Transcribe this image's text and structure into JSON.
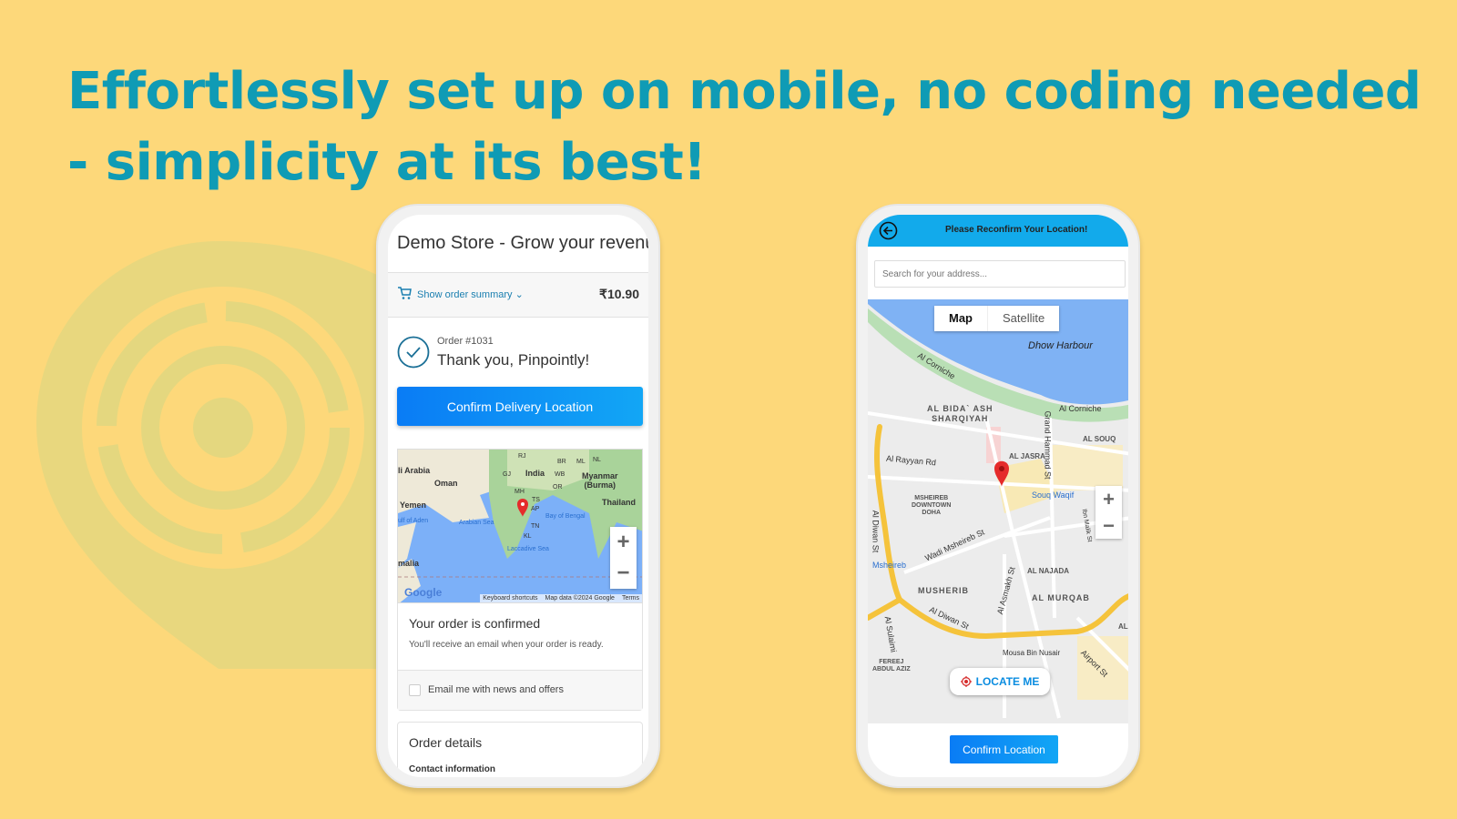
{
  "headline": "Effortlessly set up on mobile, no coding needed - simplicity at its best!",
  "colors": {
    "background": "#fdd87a",
    "headline": "#0f9bb5",
    "primary_button": "#0a8cf5",
    "header_blue": "#12aaeb"
  },
  "left_phone": {
    "store_title": "Demo Store - Grow your revenue",
    "order_summary_label": "Show order summary",
    "order_total": "₹10.90",
    "order_number": "Order #1031",
    "thank_you": "Thank you, Pinpointly!",
    "confirm_button": "Confirm Delivery Location",
    "map": {
      "labels": [
        "li Arabia",
        "Oman",
        "Yemen",
        "India",
        "Myanmar\n(Burma)",
        "Thailand",
        "malia",
        "RJ",
        "GJ",
        "MH",
        "TS",
        "AP",
        "TN",
        "KL",
        "BR",
        "WB",
        "OR",
        "ML",
        "NL"
      ],
      "water_labels": [
        "ulf of Aden",
        "Arabian Sea",
        "Bay of Bengal",
        "Laccadive Sea"
      ],
      "google": "Google",
      "footer": [
        "Keyboard shortcuts",
        "Map data ©2024 Google",
        "Terms"
      ],
      "zoom_in": "+",
      "zoom_out": "−"
    },
    "confirmed_title": "Your order is confirmed",
    "confirmed_text": "You'll receive an email when your order is ready.",
    "email_checkbox_label": "Email me with news and offers",
    "email_checked": false,
    "order_details_title": "Order details",
    "contact_info_label": "Contact information"
  },
  "right_phone": {
    "header_title": "Please Reconfirm Your Location!",
    "search_placeholder": "Search for your address...",
    "map_tabs": [
      "Map",
      "Satellite"
    ],
    "active_tab": "Map",
    "map_labels": {
      "dhow": "Dhow Harbour",
      "corniche1": "Al Corniche",
      "corniche2": "Al Corniche",
      "bida": "AL BIDA` ASH\nSHARQIYAH",
      "souq": "AL SOUQ",
      "jasra": "AL JASRA",
      "rayyan": "Al Rayyan Rd",
      "grand": "Grand Hammad St",
      "souqwaqif": "Souq Waqif",
      "msheireb_dt": "MSHEIREB\nDOWNTOWN\nDOHA",
      "diwan": "Al Diwan St",
      "wadi": "Wadi Msheireb St",
      "msheireb": "Msheireb",
      "musherib": "MUSHERIB",
      "najada": "AL NAJADA",
      "asmakh": "Al Asmakh St",
      "murqab": "AL MURQAB",
      "diwan2": "Al Diwan St",
      "sulaimi": "Al Sulaimi",
      "fereej": "FEREEJ\nABDUL AZIZ",
      "mousa": "Mousa Bin Nusair",
      "airport": "Airport St",
      "ibnmalik": "Ibn Malik St",
      "al": "AL"
    },
    "zoom_in": "+",
    "zoom_out": "−",
    "locate_me": "LOCATE ME",
    "confirm_button": "Confirm Location"
  }
}
